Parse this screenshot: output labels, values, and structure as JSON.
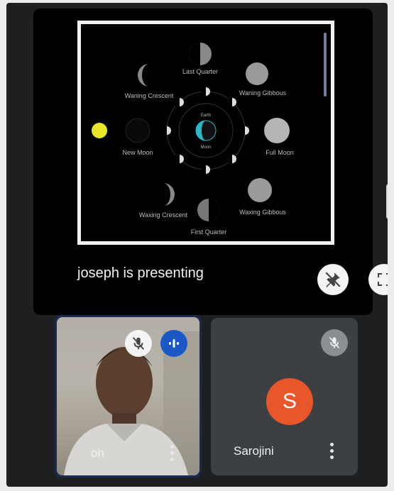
{
  "presentation": {
    "label": "joseph is presenting",
    "slide_labels": {
      "top": "Last Quarter",
      "upper_left": "Waning Crescent",
      "upper_right": "Waning Gibbous",
      "left": "New Moon",
      "right": "Full Moon",
      "lower_left": "Waxing Crescent",
      "lower_right": "Waxing Gibbous",
      "bottom": "First Quarter",
      "center_top": "Earth",
      "center_bottom": "Moon"
    },
    "pin_icon": "pin-off-icon",
    "fullscreen_icon": "fullscreen-icon"
  },
  "participants": [
    {
      "name": "oh",
      "avatar_initial": "",
      "muted": true,
      "speaking": true
    },
    {
      "name": "Sarojini",
      "avatar_initial": "S",
      "avatar_color": "#e8562a",
      "muted": true
    }
  ],
  "colors": {
    "speaking": "#1a58c8",
    "background": "#1e1f21",
    "tile": "#3c4043"
  }
}
